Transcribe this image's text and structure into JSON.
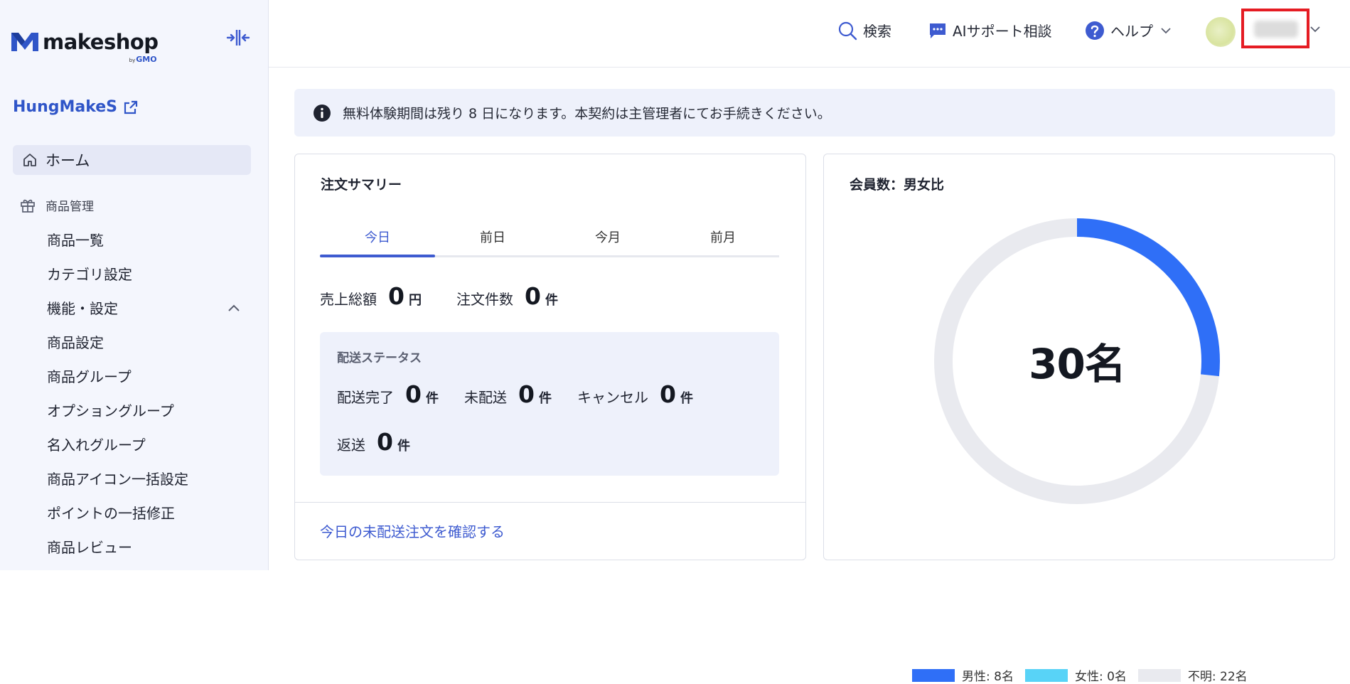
{
  "brand": {
    "name": "makeshop",
    "by": "by",
    "company": "GMO",
    "accent": "#2f55c8"
  },
  "sidebar": {
    "shop_name": "HungMakeS",
    "home_label": "ホーム",
    "section_label": "商品管理",
    "items": [
      {
        "label": "商品一覧"
      },
      {
        "label": "カテゴリ設定"
      }
    ],
    "group_label": "機能・設定",
    "group_items": [
      {
        "label": "商品設定"
      },
      {
        "label": "商品グループ"
      },
      {
        "label": "オプショングループ"
      },
      {
        "label": "名入れグループ"
      },
      {
        "label": "商品アイコン一括設定"
      },
      {
        "label": "ポイントの一括修正"
      },
      {
        "label": "商品レビュー"
      }
    ]
  },
  "header": {
    "search_label": "検索",
    "ai_label": "AIサポート相談",
    "help_label": "ヘルプ"
  },
  "banner": {
    "text": "無料体験期間は残り 8 日になります。本契約は主管理者にてお手続きください。"
  },
  "order_summary": {
    "title": "注文サマリー",
    "tabs": [
      "今日",
      "前日",
      "今月",
      "前月"
    ],
    "active_tab": "今日",
    "sales_label": "売上総額",
    "sales_value": "0",
    "sales_unit": "円",
    "orders_label": "注文件数",
    "orders_value": "0",
    "orders_unit": "件",
    "shipping": {
      "title": "配送ステータス",
      "items": [
        {
          "label": "配送完了",
          "value": "0",
          "unit": "件"
        },
        {
          "label": "未配送",
          "value": "0",
          "unit": "件"
        },
        {
          "label": "キャンセル",
          "value": "0",
          "unit": "件"
        },
        {
          "label": "返送",
          "value": "0",
          "unit": "件"
        }
      ]
    },
    "link_label": "今日の未配送注文を確認する"
  },
  "members": {
    "title": "会員数：男女比",
    "total_label": "30名",
    "chart_data": {
      "type": "pie",
      "categories": [
        "男性",
        "女性",
        "不明"
      ],
      "values": [
        8,
        0,
        22
      ],
      "colors": [
        "#2f6ff7",
        "#58d3f7",
        "#e9eaef"
      ],
      "legend": [
        {
          "label": "男性: 8名",
          "color": "#2f6ff7"
        },
        {
          "label": "女性: 0名",
          "color": "#58d3f7"
        },
        {
          "label": "不明: 22名",
          "color": "#e9eaef"
        }
      ],
      "legend_position": "bottom"
    }
  }
}
